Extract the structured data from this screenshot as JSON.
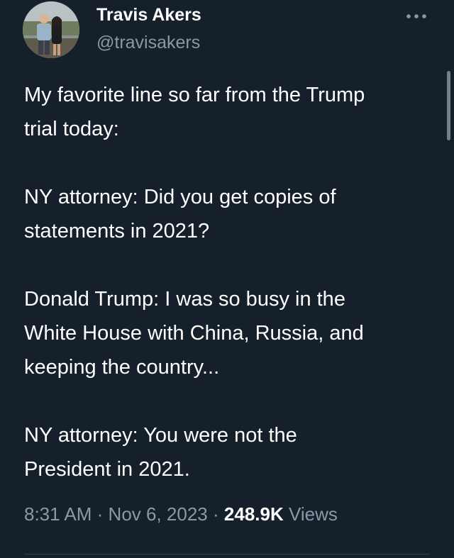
{
  "author": {
    "name": "Travis Akers",
    "handle": "@travisakers",
    "avatar_icon": "profile-photo-icon"
  },
  "menu": {
    "more_icon": "more-horizontal-icon"
  },
  "tweet": {
    "paragraphs": [
      [
        "My favorite line so far from the Trump",
        "trial today:"
      ],
      [
        "NY attorney: Did you get copies of",
        "statements in 2021?"
      ],
      [
        "Donald Trump: I was so busy in the",
        "White House with China, Russia, and",
        "keeping the country..."
      ],
      [
        "NY attorney: You were not the",
        "President in 2021."
      ]
    ]
  },
  "meta": {
    "time": "8:31 AM",
    "separator": "·",
    "date": "Nov 6, 2023",
    "views_count": "248.9K",
    "views_label": "Views"
  },
  "colors": {
    "background": "#15202b",
    "primary_text": "#ffffff",
    "secondary_text": "#8b98a5",
    "divider": "#38444d"
  }
}
